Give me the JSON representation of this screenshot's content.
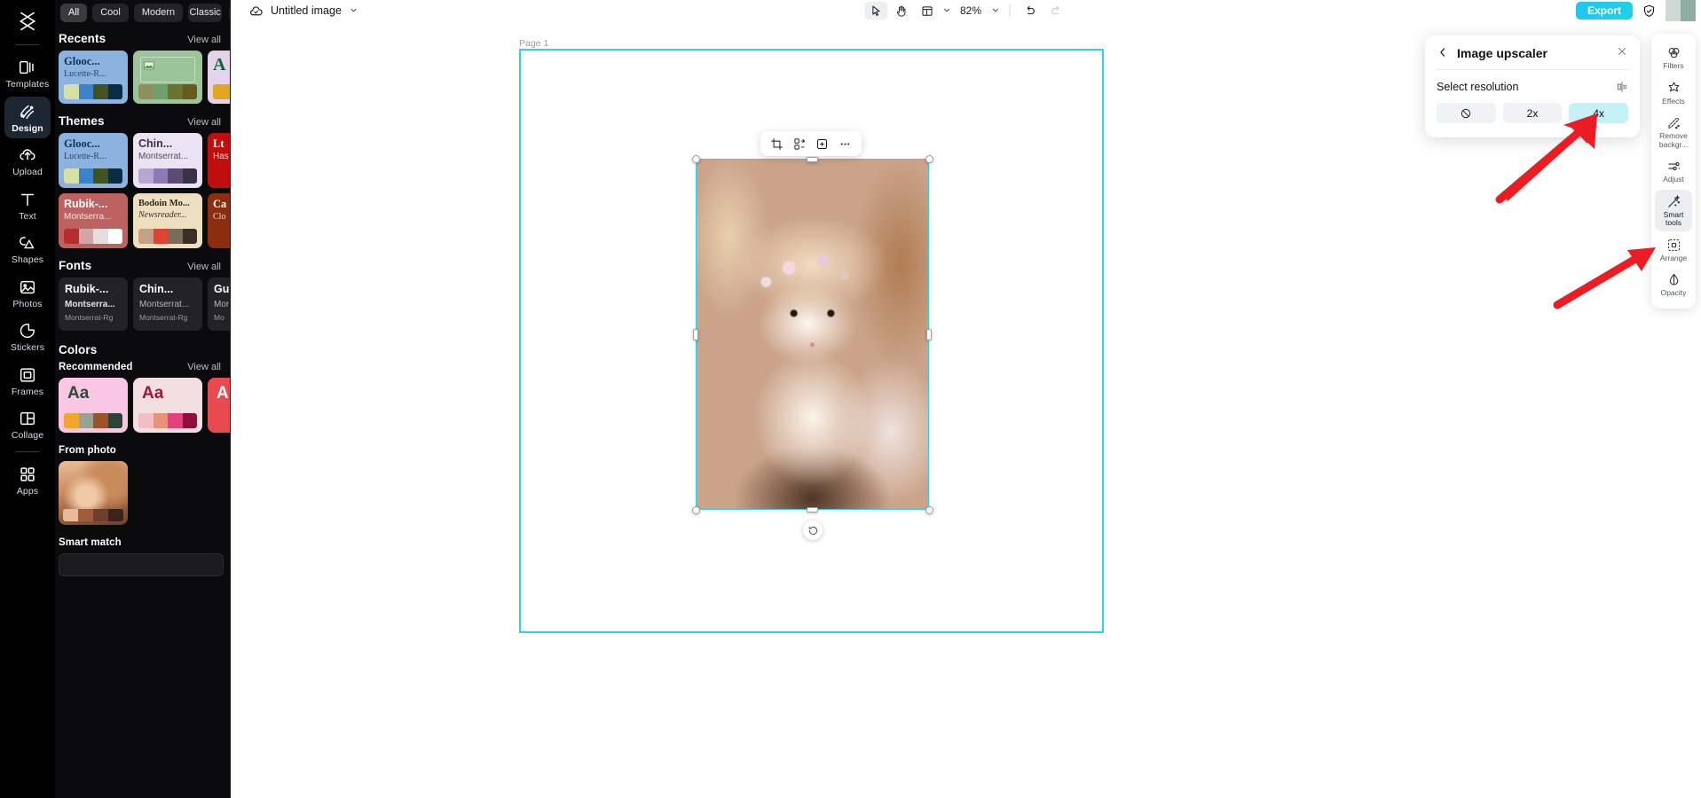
{
  "rail": {
    "logo_icon": "capcut-logo-icon",
    "items": [
      {
        "label": "Templates",
        "icon": "templates-icon",
        "active": false
      },
      {
        "label": "Design",
        "icon": "design-icon",
        "active": true
      },
      {
        "label": "Upload",
        "icon": "upload-cloud-icon",
        "active": false
      },
      {
        "label": "Text",
        "icon": "text-t-icon",
        "active": false
      },
      {
        "label": "Shapes",
        "icon": "shapes-icon",
        "active": false
      },
      {
        "label": "Photos",
        "icon": "photos-image-icon",
        "active": false
      },
      {
        "label": "Stickers",
        "icon": "stickers-icon",
        "active": false
      },
      {
        "label": "Frames",
        "icon": "frames-icon",
        "active": false
      },
      {
        "label": "Collage",
        "icon": "collage-icon",
        "active": false
      },
      {
        "label": "Apps",
        "icon": "apps-grid-icon",
        "active": false
      }
    ]
  },
  "left_panel": {
    "chips": [
      {
        "label": "All",
        "active": true
      },
      {
        "label": "Cool",
        "active": false
      },
      {
        "label": "Modern",
        "active": false
      },
      {
        "label": "Classic",
        "active": false
      }
    ],
    "chip_more_icon": "chevron-down-icon",
    "view_all_label": "View all",
    "sections": {
      "recents": {
        "title": "Recents",
        "cards": [
          {
            "t1": "Glooc...",
            "t2": "Lucette-R...",
            "bg": "#8cb3e0",
            "t1color": "#14314d",
            "t2color": "#2a4a66",
            "swatches": [
              "#d6dfa4",
              "#3b82cb",
              "#44521f",
              "#0b2d44"
            ]
          },
          {
            "t1": "",
            "t2": "",
            "bg": "#9cc49a",
            "t1color": "#1d4a24",
            "t2color": "#1d4a24",
            "swatches": [
              "#8e8f5e",
              "#6f9e6f",
              "#6a7232",
              "#69591e"
            ],
            "image_placeholder": true
          },
          {
            "t1": "A",
            "t2": "",
            "bg": "#e3d4ec",
            "t1color": "#14603a",
            "t2color": "#14603a",
            "swatches": [
              "#e0a81c",
              "#e0a81c",
              "#e0a81c",
              "#e0a81c"
            ]
          }
        ]
      },
      "themes": {
        "title": "Themes",
        "cards": [
          {
            "t1": "Glooc...",
            "t2": "Lucette-R...",
            "bg": "#8cb3e0",
            "t1color": "#14314d",
            "t2color": "#2a4a66",
            "swatches": [
              "#d6dfa4",
              "#3b82cb",
              "#44521f",
              "#0b2d44"
            ]
          },
          {
            "t1": "Chin...",
            "t2": "Montserrat...",
            "bg": "#ece3f2",
            "t1color": "#3c2f4a",
            "t2color": "#57495f",
            "swatches": [
              "#b6a6d4",
              "#8f78b4",
              "#5e4b74",
              "#3b2f4a"
            ]
          },
          {
            "t1": "Lt",
            "t2": "Has",
            "bg": "#c00d0d",
            "t1color": "#ffffff",
            "t2color": "#f2d5d5",
            "swatches": [
              "#c00d0d",
              "#c00d0d",
              "#c00d0d",
              "#c00d0d"
            ]
          },
          {
            "t1": "Rubik-...",
            "t2": "Montserra...",
            "bg": "#bd6161",
            "t1color": "#ffffff",
            "t2color": "#f6e6e6",
            "swatches": [
              "#b52e2e",
              "#cfa5a5",
              "#e6dede",
              "#ffffff"
            ]
          },
          {
            "t1": "Bodoin Mo...",
            "t2": "Newsreader...",
            "bg": "#eedfc0",
            "t1color": "#2e2a24",
            "t2color": "#3a332b",
            "swatches": [
              "#c3a086",
              "#e0442f",
              "#7b6b5a",
              "#3a2f24"
            ]
          },
          {
            "t1": "Ca",
            "t2": "Clo",
            "bg": "#8c2d10",
            "t1color": "#ffffff",
            "t2color": "#f0d9cf",
            "swatches": [
              "#8c2d10",
              "#8c2d10",
              "#8c2d10",
              "#8c2d10"
            ]
          }
        ]
      },
      "fonts": {
        "title": "Fonts",
        "cards": [
          {
            "f1": "Rubik-...",
            "f2": "Montserra...",
            "f3": "Montserrat-Rg"
          },
          {
            "f1": "Chin...",
            "f2": "Montserrat...",
            "f3": "Montserrat-Rg"
          },
          {
            "f1": "Gu",
            "f2": "Mor",
            "f3": "Mo"
          }
        ]
      },
      "colors": {
        "title": "Colors",
        "subtitle": "Recommended",
        "cards": [
          {
            "aa": "Aa",
            "bg": "#f9c6e4",
            "aacolor": "#2d4a37",
            "swatches": [
              "#efa72c",
              "#98a193",
              "#9c5329",
              "#2e4238"
            ]
          },
          {
            "aa": "Aa",
            "bg": "#f3dfe1",
            "aacolor": "#9e1440",
            "swatches": [
              "#f2bdc6",
              "#e99279",
              "#e53f7e",
              "#8f0f3a"
            ]
          },
          {
            "aa": "A",
            "bg": "#e84a50",
            "aacolor": "#ffffff",
            "swatches": [
              "#e84a50",
              "#e84a50",
              "#e84a50",
              "#e84a50"
            ]
          }
        ]
      },
      "from_photo": {
        "title": "From photo",
        "swatches": [
          "#e8b89a",
          "#a05c3d",
          "#6d3f2c",
          "#3c2419"
        ]
      },
      "smart_match": {
        "title": "Smart match"
      }
    }
  },
  "topbar": {
    "cloud_icon": "cloud-check-icon",
    "doc_title": "Untitled image",
    "title_caret_icon": "chevron-down-icon",
    "tools": [
      {
        "name": "select-tool",
        "icon": "cursor-arrow-icon",
        "active": true
      },
      {
        "name": "hand-tool",
        "icon": "hand-icon",
        "active": false
      },
      {
        "name": "layout-tool",
        "icon": "layout-grid-icon",
        "active": false
      }
    ],
    "layout_caret_icon": "chevron-down-icon",
    "zoom_value": "82%",
    "zoom_caret_icon": "chevron-down-icon",
    "undo_icon": "undo-icon",
    "redo_icon": "redo-icon",
    "export_label": "Export",
    "shield_icon": "shield-check-icon",
    "avatar_name": "user-avatar"
  },
  "canvas": {
    "page_label": "Page 1",
    "element_toolbar": [
      {
        "name": "crop-button",
        "icon": "crop-icon"
      },
      {
        "name": "remove-bg-button",
        "icon": "cutout-icon"
      },
      {
        "name": "duplicate-button",
        "icon": "duplicate-icon"
      },
      {
        "name": "more-options-button",
        "icon": "ellipsis-icon"
      }
    ],
    "rotate_icon": "rotate-icon",
    "selection_color": "#2bd4e8"
  },
  "upscaler": {
    "back_icon": "chevron-left-icon",
    "title": "Image upscaler",
    "close_icon": "close-x-icon",
    "resolution_label": "Select resolution",
    "compare_icon": "compare-split-icon",
    "options": [
      {
        "label": "",
        "icon": "none-slash-icon",
        "selected": false,
        "name": "resolution-none"
      },
      {
        "label": "2x",
        "icon": "",
        "selected": false,
        "name": "resolution-2x"
      },
      {
        "label": "4x",
        "icon": "",
        "selected": true,
        "name": "resolution-4x"
      }
    ],
    "selected_color": "#c5f0f5"
  },
  "right_rail": {
    "items": [
      {
        "label": "Filters",
        "icon": "filters-circles-icon",
        "active": false
      },
      {
        "label": "Effects",
        "icon": "effects-star-icon",
        "active": false
      },
      {
        "label": "Remove backgr...",
        "icon": "remove-background-icon",
        "active": false
      },
      {
        "label": "Adjust",
        "icon": "adjust-sliders-icon",
        "active": false
      },
      {
        "label": "Smart tools",
        "icon": "smart-tools-wand-icon",
        "active": true
      },
      {
        "label": "Arrange",
        "icon": "arrange-icon",
        "active": false
      },
      {
        "label": "Opacity",
        "icon": "opacity-drop-icon",
        "active": false
      }
    ]
  },
  "annotations": {
    "arrow_color": "#ec1c24",
    "arrows": [
      {
        "name": "arrow-to-4x-button"
      },
      {
        "name": "arrow-to-smart-tools"
      }
    ]
  }
}
